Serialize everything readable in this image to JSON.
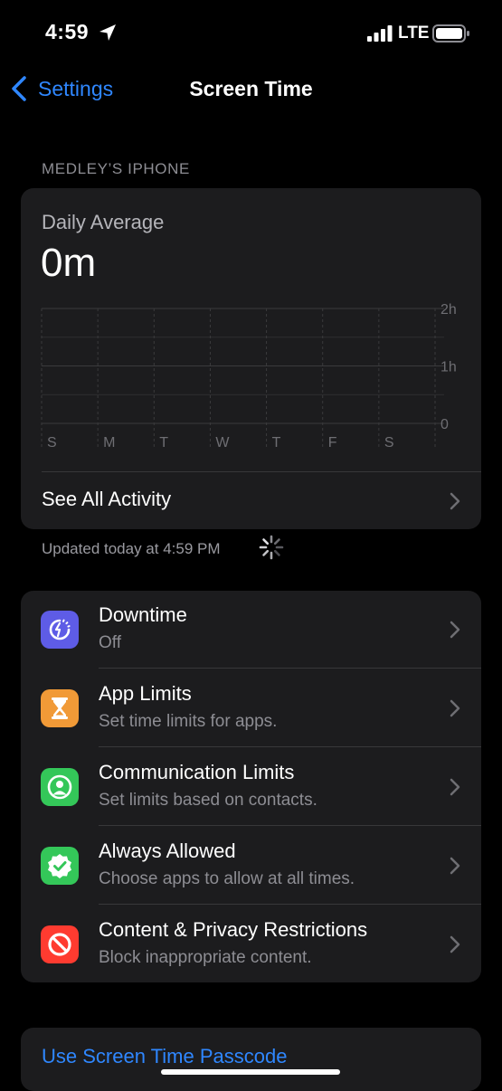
{
  "status_bar": {
    "time": "4:59",
    "network": "LTE",
    "icons": [
      "location-arrow-icon",
      "signal-bars-icon",
      "battery-icon"
    ]
  },
  "nav": {
    "back_label": "Settings",
    "title": "Screen Time",
    "back_icon": "chevron-left-icon"
  },
  "device_header": "MEDLEY’S IPHONE",
  "usage": {
    "daily_label": "Daily Average",
    "daily_value": "0m",
    "see_all_label": "See All Activity"
  },
  "chart_data": {
    "type": "bar",
    "categories": [
      "S",
      "M",
      "T",
      "W",
      "T",
      "F",
      "S"
    ],
    "values": [
      0,
      0,
      0,
      0,
      0,
      0,
      0
    ],
    "y_ticks": [
      "2h",
      "1h",
      "0"
    ],
    "ylim": [
      0,
      2
    ],
    "grid": true
  },
  "updated_text": "Updated today at 4:59 PM",
  "settings": [
    {
      "title": "Downtime",
      "subtitle": "Off",
      "icon": "downtime-icon",
      "color": "#5e5ce6"
    },
    {
      "title": "App Limits",
      "subtitle": "Set time limits for apps.",
      "icon": "hourglass-icon",
      "color": "#f19a37"
    },
    {
      "title": "Communication Limits",
      "subtitle": "Set limits based on contacts.",
      "icon": "contact-icon",
      "color": "#34c759"
    },
    {
      "title": "Always Allowed",
      "subtitle": "Choose apps to allow at all times.",
      "icon": "checkmark-seal-icon",
      "color": "#34c759"
    },
    {
      "title": "Content & Privacy Restrictions",
      "subtitle": "Block inappropriate content.",
      "icon": "restriction-icon",
      "color": "#ff3b30"
    }
  ],
  "passcode_label": "Use Screen Time Passcode",
  "colors": {
    "accent": "#2f87ff",
    "background": "#000000",
    "card": "#1c1c1e"
  }
}
